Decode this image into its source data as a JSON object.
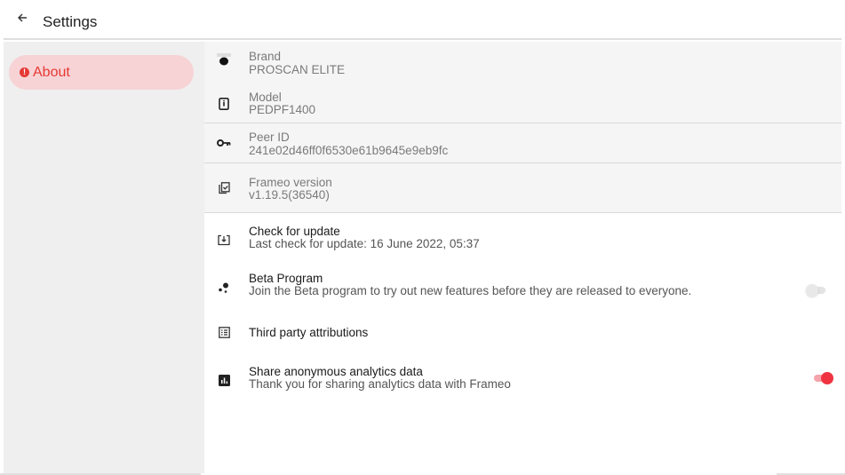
{
  "header": {
    "back_icon": "arrow-left-icon",
    "title": "Settings"
  },
  "sidebar": {
    "items": [
      {
        "label": "About",
        "icon": "info-circle-icon",
        "selected": true
      }
    ]
  },
  "colors": {
    "accent": "#e53935",
    "selected_bg": "#f7d3d5",
    "toggle_on": "#ef3340"
  },
  "info": {
    "brand": {
      "label": "Brand",
      "value": "PROSCAN ELITE",
      "icon": "brand-logo-icon"
    },
    "model": {
      "label": "Model",
      "value": "PEDPF1400",
      "icon": "device-info-icon"
    },
    "peer_id": {
      "label": "Peer ID",
      "value": "241e02d46ff0f6530e61b9645e9eb9fc",
      "icon": "key-icon"
    },
    "version": {
      "label": "Frameo version",
      "value": "v1.19.5(36540)",
      "icon": "copy-check-icon"
    }
  },
  "settings": {
    "check_update": {
      "label": "Check for update",
      "sub": "Last check for update: 16 June 2022, 05:37",
      "icon": "system-update-icon"
    },
    "beta": {
      "label": "Beta Program",
      "sub": "Join the Beta program to try out new features before they are released to everyone.",
      "icon": "bubble-chart-icon",
      "enabled": false
    },
    "attributions": {
      "label": "Third party attributions",
      "icon": "list-alt-icon"
    },
    "analytics": {
      "label": "Share anonymous analytics data",
      "sub": "Thank you for sharing analytics data with Frameo",
      "icon": "analytics-icon",
      "enabled": true
    }
  }
}
